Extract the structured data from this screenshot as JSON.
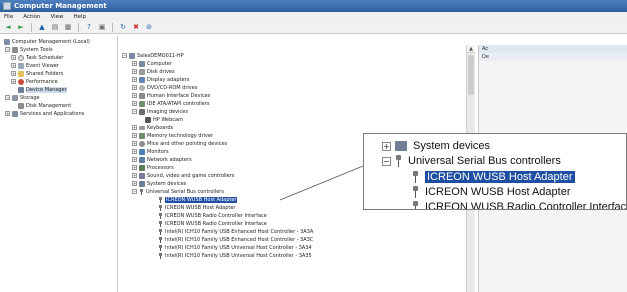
{
  "window": {
    "title": "Computer Management",
    "menu": [
      "File",
      "Action",
      "View",
      "Help"
    ],
    "toolbar_icons": [
      "back-icon",
      "forward-icon",
      "up-icon",
      "show-hide-tree-icon",
      "properties-icon",
      "help-icon",
      "scan-hardware-icon",
      "update-driver-icon",
      "uninstall-icon",
      "disable-icon"
    ]
  },
  "left_tree": [
    {
      "label": "Computer Management (Local)",
      "icon": "computer-management-icon",
      "expander": ""
    },
    {
      "label": "System Tools",
      "icon": "tools-icon",
      "expander": "−"
    },
    {
      "label": "Task Scheduler",
      "icon": "clock-icon",
      "expander": "+"
    },
    {
      "label": "Event Viewer",
      "icon": "event-viewer-icon",
      "expander": "+"
    },
    {
      "label": "Shared Folders",
      "icon": "folder-icon",
      "expander": "+"
    },
    {
      "label": "Performance",
      "icon": "performance-icon",
      "expander": "+"
    },
    {
      "label": "Device Manager",
      "icon": "device-manager-icon",
      "expander": ""
    },
    {
      "label": "Storage",
      "icon": "storage-icon",
      "expander": "−"
    },
    {
      "label": "Disk Management",
      "icon": "disk-icon",
      "expander": ""
    },
    {
      "label": "Services and Applications",
      "icon": "services-icon",
      "expander": "+"
    }
  ],
  "device_tree": [
    {
      "label": "SalesDEMO011-HP",
      "icon": "computer-icon",
      "expander": "−"
    },
    {
      "label": "Computer",
      "icon": "computer-icon",
      "expander": "+"
    },
    {
      "label": "Disk drives",
      "icon": "disk-icon",
      "expander": "+"
    },
    {
      "label": "Display adapters",
      "icon": "display-icon",
      "expander": "+"
    },
    {
      "label": "DVD/CD-ROM drives",
      "icon": "dvd-icon",
      "expander": "+"
    },
    {
      "label": "Human Interface Devices",
      "icon": "hid-icon",
      "expander": "+"
    },
    {
      "label": "IDE ATA/ATAPI controllers",
      "icon": "ide-icon",
      "expander": "+"
    },
    {
      "label": "Imaging devices",
      "icon": "camera-icon",
      "expander": "−"
    },
    {
      "label": "HP Webcam",
      "icon": "webcam-icon",
      "expander": ""
    },
    {
      "label": "Keyboards",
      "icon": "keyboard-icon",
      "expander": "+"
    },
    {
      "label": "Memory technology driver",
      "icon": "memory-icon",
      "expander": "+"
    },
    {
      "label": "Mice and other pointing devices",
      "icon": "mouse-icon",
      "expander": "+"
    },
    {
      "label": "Monitors",
      "icon": "monitor-icon",
      "expander": "+"
    },
    {
      "label": "Network adapters",
      "icon": "network-icon",
      "expander": "+"
    },
    {
      "label": "Processors",
      "icon": "processor-icon",
      "expander": "+"
    },
    {
      "label": "Sound, video and game controllers",
      "icon": "sound-icon",
      "expander": "+"
    },
    {
      "label": "System devices",
      "icon": "system-devices-icon",
      "expander": "+"
    },
    {
      "label": "Universal Serial Bus controllers",
      "icon": "usb-icon",
      "expander": "−"
    },
    {
      "label": "ICREON WUSB Host Adapter",
      "icon": "usb-icon",
      "expander": "",
      "selected": true
    },
    {
      "label": "ICREON WUSB Host Adapter",
      "icon": "usb-icon",
      "expander": ""
    },
    {
      "label": "ICREON WUSB Radio Controller Interface",
      "icon": "usb-icon",
      "expander": ""
    },
    {
      "label": "ICREON WUSB Radio Controller Interface",
      "icon": "usb-icon",
      "expander": ""
    },
    {
      "label": "Intel(R) ICH10 Family USB Enhanced Host Controller - 3A3A",
      "icon": "usb-icon",
      "expander": ""
    },
    {
      "label": "Intel(R) ICH10 Family USB Enhanced Host Controller - 3A3C",
      "icon": "usb-icon",
      "expander": ""
    },
    {
      "label": "Intel(R) ICH10 Family USB Universal Host Controller - 3A34",
      "icon": "usb-icon",
      "expander": ""
    },
    {
      "label": "Intel(R) ICH10 Family USB Universal Host Controller - 3A35",
      "icon": "usb-icon",
      "expander": ""
    }
  ],
  "actions_pane": {
    "header": "Ac",
    "sub": "De"
  },
  "zoom_callout": {
    "rows": [
      {
        "label": "System devices",
        "expander": "+"
      },
      {
        "label": "Universal Serial Bus controllers",
        "expander": "−"
      },
      {
        "label": "ICREON WUSB Host Adapter",
        "selected": true
      },
      {
        "label": "ICREON WUSB Host Adapter"
      },
      {
        "label": "ICREON WUSB Radio Controller Interface"
      }
    ]
  },
  "colors": {
    "titlebar": "#3a6aa9",
    "selection": "#1f4fa3",
    "tree_selection": "#cfdcef"
  }
}
